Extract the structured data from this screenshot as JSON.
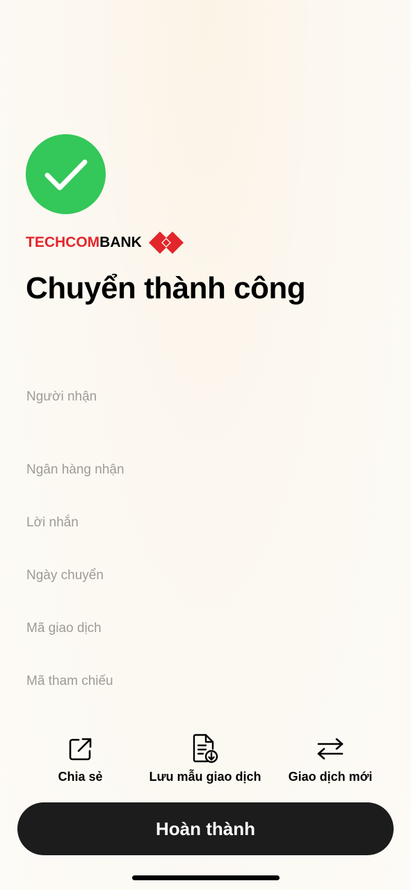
{
  "brand": {
    "name_dark": "TECHCOM",
    "name_red": "BANK",
    "logo_color": "#e3262b"
  },
  "status": {
    "icon": "checkmark-icon",
    "color": "#34c759"
  },
  "title": "Chuyển thành công",
  "fields": [
    {
      "label": "Người nhận"
    },
    {
      "label": "Ngân hàng nhận"
    },
    {
      "label": "Lời nhắn"
    },
    {
      "label": "Ngày chuyển"
    },
    {
      "label": "Mã giao dịch"
    },
    {
      "label": "Mã tham chiếu"
    }
  ],
  "actions": [
    {
      "label": "Chia sẻ",
      "icon": "share-icon"
    },
    {
      "label": "Lưu mẫu giao dịch",
      "icon": "save-template-icon"
    },
    {
      "label": "Giao dịch mới",
      "icon": "swap-arrows-icon"
    }
  ],
  "done_button": {
    "label": "Hoàn thành"
  }
}
